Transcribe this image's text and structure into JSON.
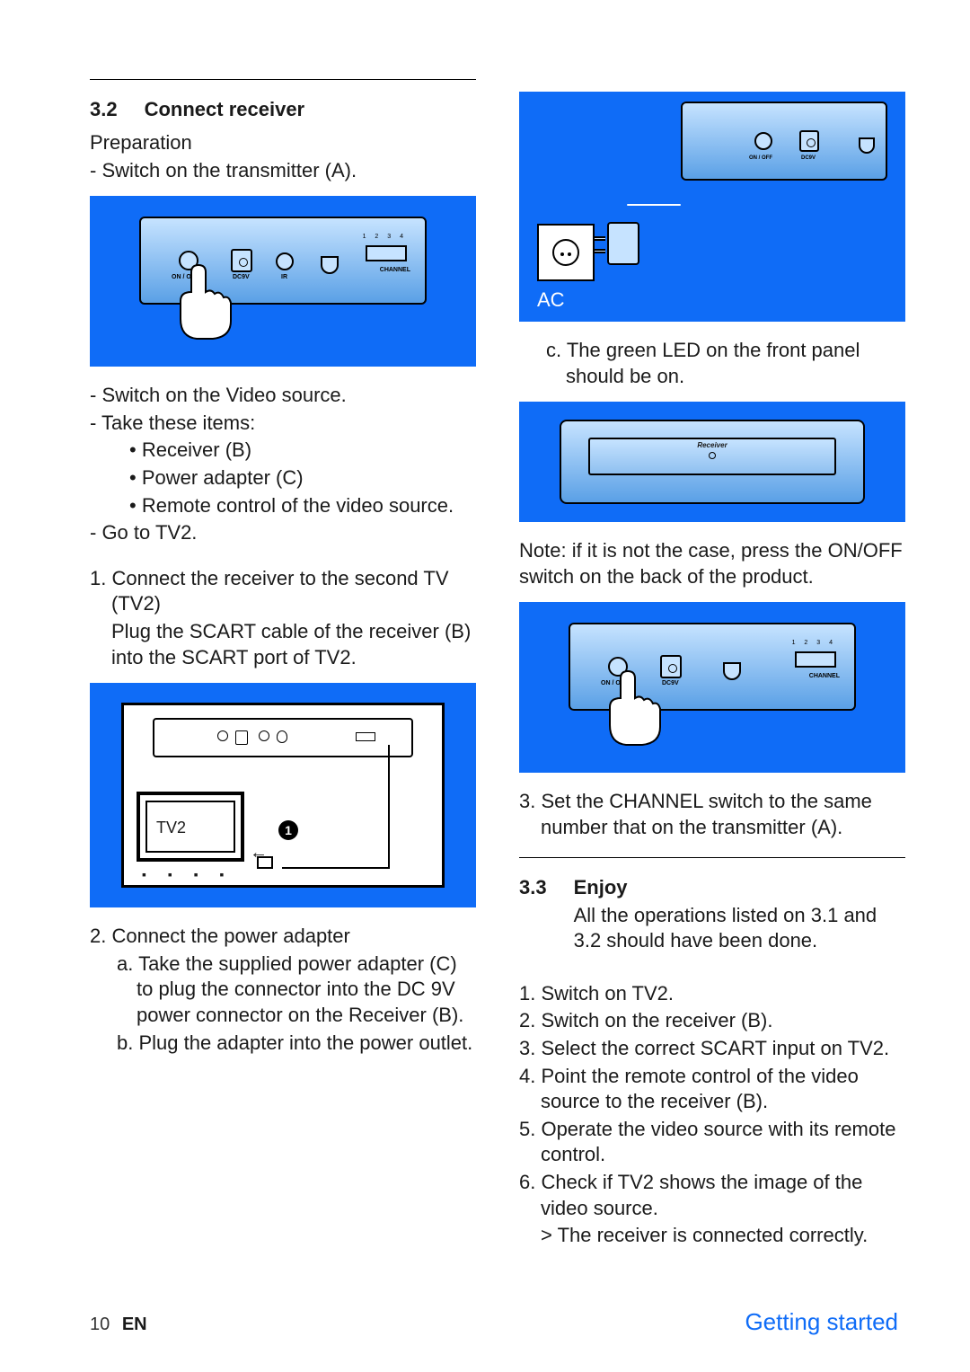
{
  "section32": {
    "number": "3.2",
    "title": "Connect receiver",
    "preparation": "Preparation",
    "prep_items": {
      "switch_tx": "- Switch on the transmitter (A).",
      "switch_video": "- Switch on the Video source.",
      "take_items": "- Take these items:",
      "item_receiver": "• Receiver (B)",
      "item_adapter": "• Power adapter (C)",
      "item_remote": "• Remote control of the video source.",
      "goto_tv2": "- Go to TV2."
    },
    "step1": {
      "title": "1. Connect the receiver to the second TV (TV2)",
      "text": "Plug the SCART cable of the receiver (B) into the SCART port of TV2."
    },
    "step2": {
      "title": "2. Connect the power adapter",
      "a": "a. Take the supplied power adapter (C) to plug the connector into the DC 9V power connector on the Receiver (B).",
      "b": "b. Plug the adapter into the power outlet."
    },
    "step2c": "c. The green LED on the front panel should be on.",
    "note": "Note: if it is not the case, press the ON/OFF switch on the back of the product.",
    "step3": "3. Set the CHANNEL switch to the same number that on the transmitter (A)."
  },
  "section33": {
    "number": "3.3",
    "title": "Enjoy",
    "intro": "All the operations listed on 3.1 and 3.2 should have been done.",
    "steps": {
      "s1": "1. Switch on TV2.",
      "s2": "2. Switch on the receiver (B).",
      "s3": "3. Select the correct SCART input on TV2.",
      "s4": "4. Point the remote control of the video source to the receiver (B).",
      "s5": "5. Operate the video source with its remote control.",
      "s6": "6. Check if TV2 shows the image of the video source.",
      "s6r": "> The receiver is connected correctly."
    }
  },
  "labels": {
    "tv2": "TV2",
    "ac": "AC",
    "onoff": "ON / OFF",
    "dc9v": "DC9V",
    "ir": "IR",
    "channel": "CHANNEL",
    "nums": "1 2 3 4",
    "receiver": "Receiver",
    "badge1": "1"
  },
  "footer": {
    "page": "10",
    "lang": "EN",
    "section": "Getting started"
  }
}
